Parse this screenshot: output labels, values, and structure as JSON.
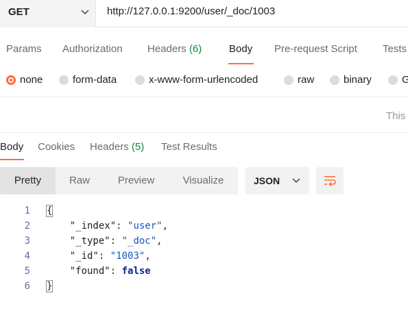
{
  "request": {
    "method": "GET",
    "url": "http://127.0.0.1:9200/user/_doc/1003"
  },
  "request_tabs": [
    {
      "label": "Params"
    },
    {
      "label": "Authorization"
    },
    {
      "label": "Headers",
      "count": "(6)"
    },
    {
      "label": "Body",
      "active": true
    },
    {
      "label": "Pre-request Script"
    },
    {
      "label": "Tests"
    }
  ],
  "body_types": [
    {
      "label": "none",
      "selected": true
    },
    {
      "label": "form-data"
    },
    {
      "label": "x-www-form-urlencoded"
    },
    {
      "label": "raw"
    },
    {
      "label": "binary"
    },
    {
      "label": "G"
    }
  ],
  "body_hint": "This",
  "response_tabs": [
    {
      "label": "Body",
      "active": true
    },
    {
      "label": "Cookies"
    },
    {
      "label": "Headers",
      "count": "(5)"
    },
    {
      "label": "Test Results"
    }
  ],
  "view_modes": [
    "Pretty",
    "Raw",
    "Preview",
    "Visualize"
  ],
  "active_view": "Pretty",
  "format": "JSON",
  "icons": {
    "method_dropdown": "chevron-down-icon",
    "format_dropdown": "chevron-down-icon",
    "wrap": "wrap-lines-icon"
  },
  "colors": {
    "accent": "#ff6c37",
    "count": "#0f8b38",
    "string": "#1557b8",
    "keyword": "#0b2a8a"
  },
  "code_lines": [
    {
      "num": "1",
      "text": "{"
    },
    {
      "num": "2",
      "key": "\"_index\"",
      "value": "\"user\"",
      "trail": ","
    },
    {
      "num": "3",
      "key": "\"_type\"",
      "value": "\"_doc\"",
      "trail": ","
    },
    {
      "num": "4",
      "key": "\"_id\"",
      "value": "\"1003\"",
      "trail": ","
    },
    {
      "num": "5",
      "key": "\"found\"",
      "value": "false",
      "trail": ""
    },
    {
      "num": "6",
      "text": "}"
    }
  ]
}
